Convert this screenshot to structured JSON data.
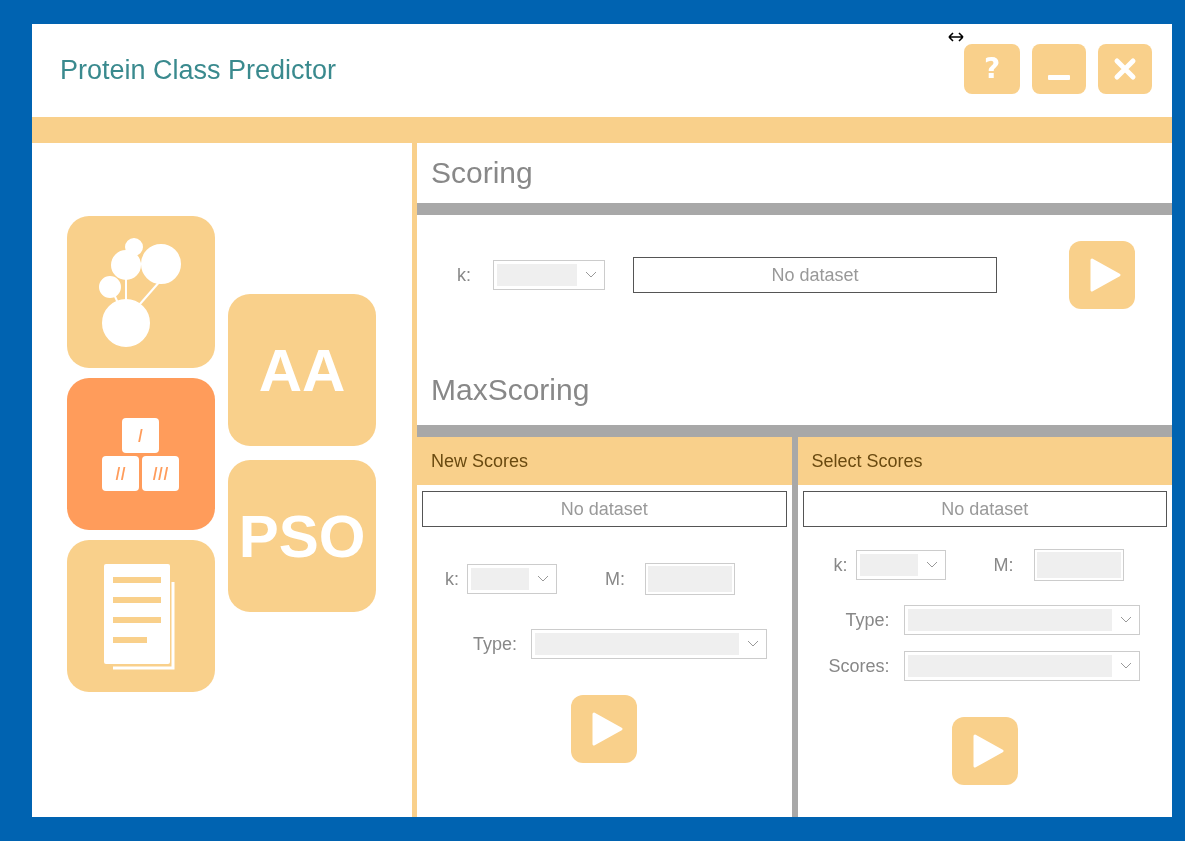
{
  "window": {
    "title": "Protein Class Predictor",
    "buttons": [
      {
        "kind": "help",
        "label": "?"
      },
      {
        "kind": "minimize"
      },
      {
        "kind": "close"
      }
    ]
  },
  "sidebar": {
    "tiles": [
      {
        "kind": "graph",
        "selected": false
      },
      {
        "kind": "blocks",
        "selected": true,
        "labels": [
          "I",
          "II",
          "III"
        ]
      },
      {
        "kind": "document",
        "selected": false
      },
      {
        "kind": "text",
        "label": "AA",
        "selected": false
      },
      {
        "kind": "text",
        "label": "PSO",
        "selected": false
      }
    ]
  },
  "scoring": {
    "title": "Scoring",
    "k_label": "k:",
    "dataset": "No dataset"
  },
  "maxscoring": {
    "title": "MaxScoring",
    "panels": [
      {
        "title": "New Scores",
        "dataset": "No dataset",
        "k_label": "k:",
        "m_label": "M:",
        "fields": [
          {
            "label": "Type:"
          }
        ]
      },
      {
        "title": "Select Scores",
        "dataset": "No dataset",
        "k_label": "k:",
        "m_label": "M:",
        "fields": [
          {
            "label": "Type:"
          },
          {
            "label": "Scores:"
          }
        ]
      }
    ]
  }
}
